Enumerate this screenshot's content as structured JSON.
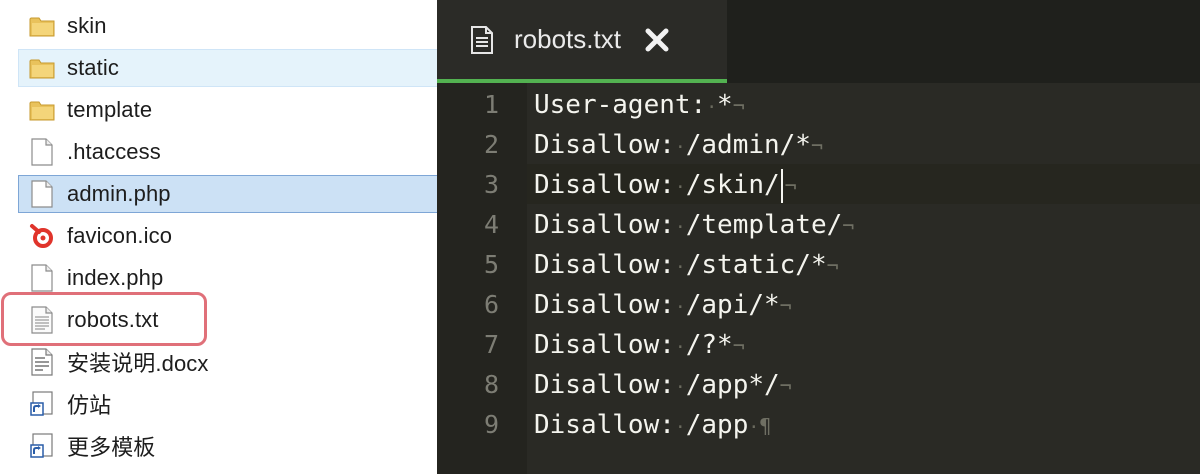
{
  "explorer": {
    "files": [
      {
        "name": "skin",
        "type": "folder",
        "state": "normal",
        "icon": "folder-icon"
      },
      {
        "name": "static",
        "type": "folder",
        "state": "hover",
        "icon": "folder-icon"
      },
      {
        "name": "template",
        "type": "folder",
        "state": "normal",
        "icon": "folder-icon"
      },
      {
        "name": ".htaccess",
        "type": "file",
        "state": "normal",
        "icon": "blank-file-icon"
      },
      {
        "name": "admin.php",
        "type": "file",
        "state": "selected",
        "icon": "blank-file-icon"
      },
      {
        "name": "favicon.ico",
        "type": "ico",
        "state": "normal",
        "icon": "favicon-icon"
      },
      {
        "name": "index.php",
        "type": "file",
        "state": "normal",
        "icon": "blank-file-icon"
      },
      {
        "name": "robots.txt",
        "type": "txt",
        "state": "highlighted",
        "icon": "text-file-icon"
      },
      {
        "name": "安装说明.docx",
        "type": "docx",
        "state": "normal",
        "icon": "document-file-icon"
      },
      {
        "name": "仿站",
        "type": "shortcut",
        "state": "normal",
        "icon": "shortcut-icon"
      },
      {
        "name": "更多模板",
        "type": "shortcut",
        "state": "normal",
        "icon": "shortcut-icon"
      }
    ],
    "colors": {
      "hover": "#e5f3fb",
      "selected": "#cce1f5",
      "highlight_border": "#e07079"
    }
  },
  "editor": {
    "tab": {
      "title": "robots.txt",
      "icon": "document-icon",
      "close_icon": "close-icon"
    },
    "cursor_line": 3,
    "lines": [
      {
        "num": "1",
        "parts": [
          "User-agent:",
          "*"
        ],
        "eol": "¬"
      },
      {
        "num": "2",
        "parts": [
          "Disallow:",
          "/admin/*"
        ],
        "eol": "¬"
      },
      {
        "num": "3",
        "parts": [
          "Disallow:",
          "/skin/"
        ],
        "eol": "¬"
      },
      {
        "num": "4",
        "parts": [
          "Disallow:",
          "/template/"
        ],
        "eol": "¬"
      },
      {
        "num": "5",
        "parts": [
          "Disallow:",
          "/static/*"
        ],
        "eol": "¬"
      },
      {
        "num": "6",
        "parts": [
          "Disallow:",
          "/api/*"
        ],
        "eol": "¬"
      },
      {
        "num": "7",
        "parts": [
          "Disallow:",
          "/?*"
        ],
        "eol": "¬"
      },
      {
        "num": "8",
        "parts": [
          "Disallow:",
          "/app*/"
        ],
        "eol": "¬"
      },
      {
        "num": "9",
        "parts": [
          "Disallow:",
          "/app"
        ],
        "eol": "¶"
      }
    ],
    "whitespace_marker": "·",
    "colors": {
      "background": "#2b2b27",
      "tab_underline": "#53b251",
      "text": "#f4f4ee",
      "line_number": "#7d7d74"
    }
  }
}
